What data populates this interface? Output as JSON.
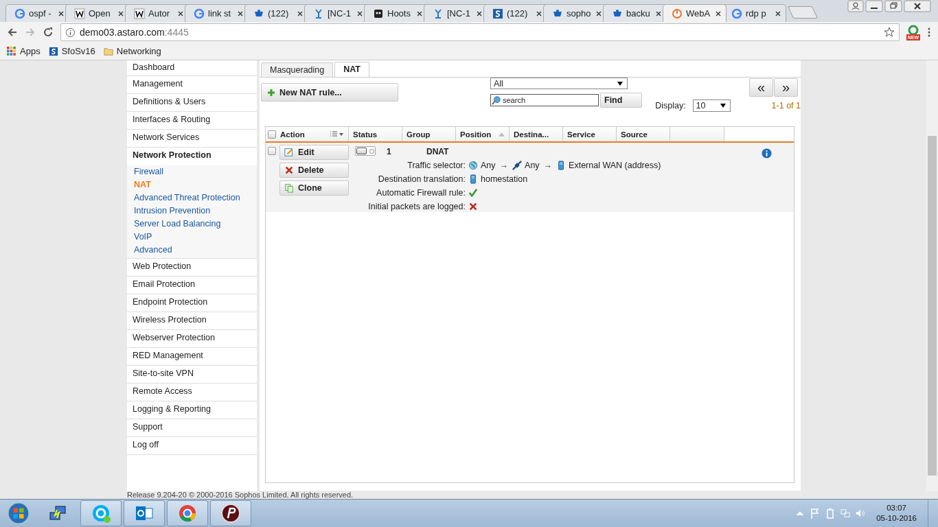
{
  "browser": {
    "tabs": [
      {
        "label": "ospf -",
        "kind": "g",
        "selected": false
      },
      {
        "label": "Open",
        "kind": "w",
        "selected": false
      },
      {
        "label": "Autor",
        "kind": "w",
        "selected": false
      },
      {
        "label": "link st",
        "kind": "g",
        "selected": false
      },
      {
        "label": "(122)",
        "kind": "cup",
        "selected": false
      },
      {
        "label": "[NC-1",
        "kind": "tool",
        "selected": false
      },
      {
        "label": "Hoots",
        "kind": "owl",
        "selected": false
      },
      {
        "label": "[NC-1",
        "kind": "tool",
        "selected": false
      },
      {
        "label": "(122)",
        "kind": "s",
        "selected": false
      },
      {
        "label": "sopho",
        "kind": "cup",
        "selected": false
      },
      {
        "label": "backu",
        "kind": "cup",
        "selected": false
      },
      {
        "label": "WebA",
        "kind": "ring",
        "selected": true
      },
      {
        "label": "rdp p",
        "kind": "g",
        "selected": false
      }
    ],
    "url_host": "demo03.astaro.com",
    "url_port": ":4445",
    "badge": "NEW",
    "bookmarks": [
      {
        "label": "Apps",
        "kind": "grid"
      },
      {
        "label": "SfoSv16",
        "kind": "s"
      },
      {
        "label": "Networking",
        "kind": "folder"
      }
    ]
  },
  "sidebar": {
    "items": [
      {
        "label": "Dashboard",
        "expanded": false
      },
      {
        "label": "Management",
        "expanded": false
      },
      {
        "label": "Definitions & Users",
        "expanded": false
      },
      {
        "label": "Interfaces & Routing",
        "expanded": false
      },
      {
        "label": "Network Services",
        "expanded": false
      },
      {
        "label": "Network Protection",
        "expanded": true,
        "children": [
          {
            "label": "Firewall",
            "selected": false
          },
          {
            "label": "NAT",
            "selected": true
          },
          {
            "label": "Advanced Threat Protection",
            "selected": false
          },
          {
            "label": "Intrusion Prevention",
            "selected": false
          },
          {
            "label": "Server Load Balancing",
            "selected": false
          },
          {
            "label": "VoIP",
            "selected": false
          },
          {
            "label": "Advanced",
            "selected": false
          }
        ]
      },
      {
        "label": "Web Protection",
        "expanded": false
      },
      {
        "label": "Email Protection",
        "expanded": false
      },
      {
        "label": "Endpoint Protection",
        "expanded": false
      },
      {
        "label": "Wireless Protection",
        "expanded": false
      },
      {
        "label": "Webserver Protection",
        "expanded": false
      },
      {
        "label": "RED Management",
        "expanded": false
      },
      {
        "label": "Site-to-site VPN",
        "expanded": false
      },
      {
        "label": "Remote Access",
        "expanded": false
      },
      {
        "label": "Logging & Reporting",
        "expanded": false
      },
      {
        "label": "Support",
        "expanded": false
      },
      {
        "label": "Log off",
        "expanded": false
      }
    ]
  },
  "tabs": [
    {
      "label": "Masquerading",
      "selected": false
    },
    {
      "label": "NAT",
      "selected": true
    }
  ],
  "toolbar": {
    "new_button": "New NAT rule...",
    "filter": "All",
    "search": {
      "placeholder": "search"
    },
    "find_button": "Find",
    "prev": "«",
    "next": "»",
    "display_label": "Display:",
    "display_value": "10",
    "range": "1-1 of 1"
  },
  "table": {
    "all_checked": false,
    "columns": [
      {
        "label": "Action",
        "kind": "action"
      },
      {
        "label": "Status",
        "kind": "plain"
      },
      {
        "label": "Group",
        "kind": "plain"
      },
      {
        "label": "Position",
        "kind": "sorted"
      },
      {
        "label": "Destina...",
        "kind": "plain"
      },
      {
        "label": "Service",
        "kind": "plain"
      },
      {
        "label": "Source",
        "kind": "plain"
      }
    ],
    "rows": [
      {
        "checked": false,
        "on": false,
        "buttons": [
          {
            "label": "Edit",
            "kind": "edit"
          },
          {
            "label": "Delete",
            "kind": "delete"
          },
          {
            "label": "Clone",
            "kind": "clone"
          }
        ],
        "number": "1",
        "name": "DNAT",
        "details": [
          {
            "label": "Traffic selector:",
            "kind": "objects",
            "items": [
              {
                "kind": "globe",
                "text": "Any"
              },
              {
                "sep": "→",
                "kind": "cable",
                "text": "Any"
              },
              {
                "sep": "→",
                "kind": "host",
                "text": "External WAN (address)"
              }
            ]
          },
          {
            "label": "Destination translation:",
            "kind": "objects",
            "items": [
              {
                "kind": "host",
                "text": "homestation"
              }
            ]
          },
          {
            "label": "Automatic Firewall rule:",
            "kind": "flag",
            "value": true
          },
          {
            "label": "Initial packets are logged:",
            "kind": "flag",
            "value": false
          }
        ]
      }
    ]
  },
  "footer": "Release 9.204-20 © 2000-2016 Sophos Limited. All rights reserved.",
  "taskbar": {
    "apps": [
      {
        "kind": "network"
      },
      {
        "kind": "skype"
      },
      {
        "kind": "outlook"
      },
      {
        "kind": "chrome"
      },
      {
        "kind": "p"
      }
    ],
    "time": "03:07",
    "date": "05-10-2016"
  }
}
